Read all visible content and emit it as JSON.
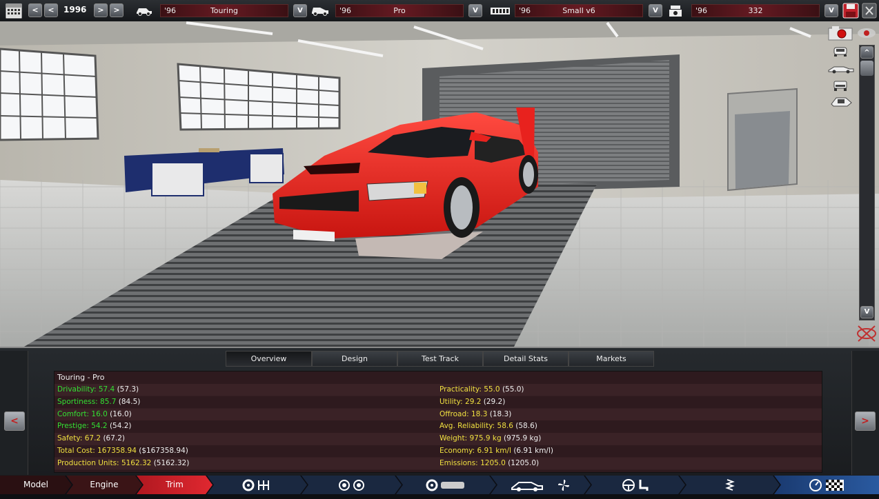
{
  "topbar": {
    "year": "1996",
    "model": {
      "year": "'96",
      "name": "Touring"
    },
    "trim": {
      "year": "'96",
      "name": "Pro"
    },
    "engine": {
      "year": "'96",
      "name": "Small v6"
    },
    "variant": {
      "year": "'96",
      "name": "332"
    },
    "prev_label": "<",
    "prev_prev_label": "<",
    "next_label": ">",
    "next_next_label": ">",
    "dropdown_label": "V"
  },
  "view": {
    "scroll_up": "^",
    "scroll_down": "V"
  },
  "tabs": [
    "Overview",
    "Design",
    "Test Track",
    "Detail Stats",
    "Markets"
  ],
  "panel": {
    "title": "Touring - Pro",
    "left_arrow": "<",
    "right_arrow": ">"
  },
  "stats_left": [
    {
      "label": "Drivability:",
      "value": "57.4",
      "prev": "(57.3)",
      "color": "green"
    },
    {
      "label": "Sportiness:",
      "value": "85.7",
      "prev": "(84.5)",
      "color": "green"
    },
    {
      "label": "Comfort:",
      "value": "16.0",
      "prev": "(16.0)",
      "color": "green"
    },
    {
      "label": "Prestige:",
      "value": "54.2",
      "prev": "(54.2)",
      "color": "green"
    },
    {
      "label": "Safety:",
      "value": "67.2",
      "prev": "(67.2)",
      "color": "yellow"
    },
    {
      "label": "Total Cost:",
      "value": "167358.94",
      "prev": "($167358.94)",
      "color": "yellow"
    },
    {
      "label": "Production Units:",
      "value": "5162.32",
      "prev": "(5162.32)",
      "color": "yellow"
    }
  ],
  "stats_right": [
    {
      "label": "Practicality:",
      "value": "55.0",
      "prev": "(55.0)",
      "color": "yellow"
    },
    {
      "label": "Utility:",
      "value": "29.2",
      "prev": "(29.2)",
      "color": "yellow"
    },
    {
      "label": "Offroad:",
      "value": "18.3",
      "prev": "(18.3)",
      "color": "yellow"
    },
    {
      "label": "Avg. Reliability:",
      "value": "58.6",
      "prev": "(58.6)",
      "color": "yellow"
    },
    {
      "label": "Weight:",
      "value": "975.9 kg",
      "prev": "(975.9 kg)",
      "color": "yellow"
    },
    {
      "label": "Economy:",
      "value": "6.91 km/l",
      "prev": "(6.91 km/l)",
      "color": "yellow"
    },
    {
      "label": "Emissions:",
      "value": "1205.0",
      "prev": "(1205.0)",
      "color": "yellow"
    }
  ],
  "bottom_nav": {
    "model": "Model",
    "engine": "Engine",
    "trim": "Trim"
  },
  "colors": {
    "green": "#33e033",
    "yellow": "#f0e040",
    "car": "#e8221e",
    "trim_tab": "#b01820"
  },
  "icons": [
    "calendar-icon",
    "car-model-icon",
    "car-trim-icon",
    "engine-icon",
    "engine-variant-icon",
    "save-icon",
    "camera-icon",
    "eye-icon",
    "gearbox-icon",
    "wheels-icon",
    "brakes-icon",
    "body-icon",
    "fan-icon",
    "steering-icon",
    "seat-icon",
    "suspension-icon",
    "gauge-icon",
    "checkered-flag-icon"
  ]
}
